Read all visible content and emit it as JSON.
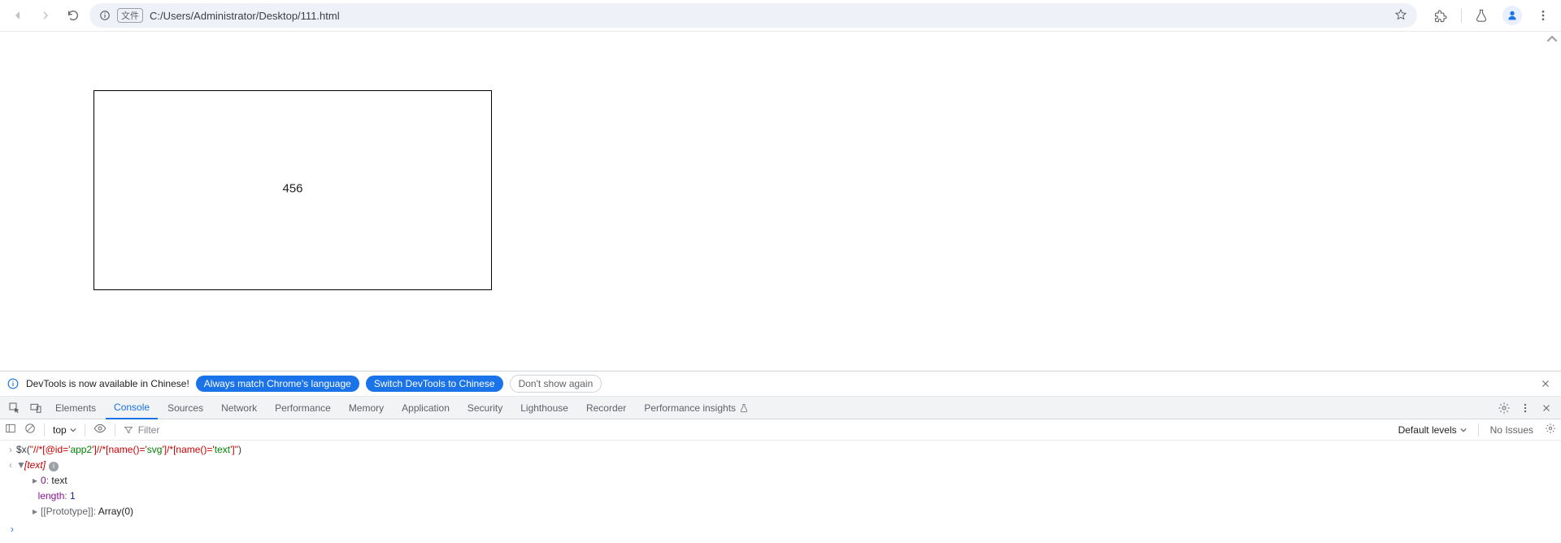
{
  "browser": {
    "file_chip": "文件",
    "url": "C:/Users/Administrator/Desktop/111.html"
  },
  "page": {
    "svg_text": "456"
  },
  "devtools": {
    "infobar": {
      "message": "DevTools is now available in Chinese!",
      "btn_always": "Always match Chrome's language",
      "btn_switch": "Switch DevTools to Chinese",
      "btn_dont": "Don't show again"
    },
    "tabs": {
      "elements": "Elements",
      "console": "Console",
      "sources": "Sources",
      "network": "Network",
      "performance": "Performance",
      "memory": "Memory",
      "application": "Application",
      "security": "Security",
      "lighthouse": "Lighthouse",
      "recorder": "Recorder",
      "perf_insights": "Performance insights"
    },
    "console_toolbar": {
      "context": "top",
      "filter_placeholder": "Filter",
      "levels": "Default levels",
      "issues": "No Issues"
    },
    "console": {
      "cmd_prefix": "$x",
      "cmd_open": "(",
      "cmd_q1": "\"//*[@id='",
      "cmd_id": "app2",
      "cmd_q2": "']//*[name()='",
      "cmd_n1": "svg",
      "cmd_q3": "']/*[name()='",
      "cmd_n2": "text",
      "cmd_q4": "']\"",
      "cmd_close": ")",
      "result_header": "[text]",
      "line0_key": "0",
      "line0_val": "text",
      "length_key": "length",
      "length_val": "1",
      "proto_key": "[[Prototype]]",
      "proto_val": "Array(0)"
    }
  }
}
